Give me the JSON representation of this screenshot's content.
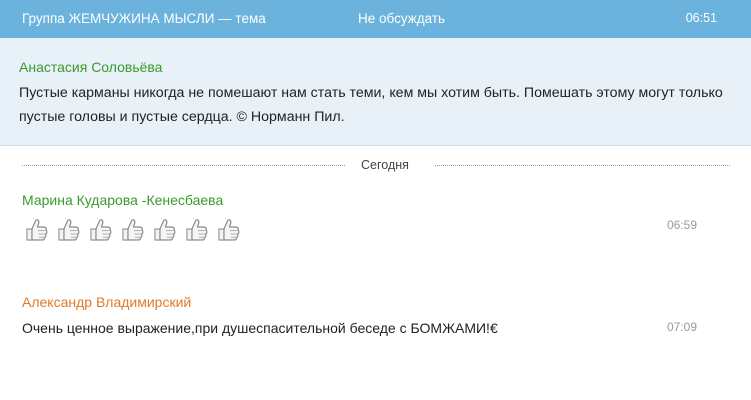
{
  "topbar": {
    "title": "Группа ЖЕМЧУЖИНА МЫСЛИ — тема",
    "mute_label": "Не обсуждать",
    "time": "06:51"
  },
  "topic": {
    "author": "Анастасия Соловьёва",
    "text": "Пустые карманы никогда не помешают нам стать теми, кем мы хотим быть. Помешать этому могут только пустые головы и пустые сердца. © Норманн Пил."
  },
  "divider": {
    "label": "Сегодня"
  },
  "messages": [
    {
      "author": "Марина Кударова -Кенесбаева",
      "time": "06:59",
      "emoji": "thumbs-up-icon",
      "emoji_count": 7
    },
    {
      "author": "Александр Владимирский",
      "time": "07:09",
      "text": "Очень ценное выражение,при душеспасительной беседе с БОМЖАМИ!€"
    }
  ],
  "colors": {
    "topbar_bg": "#6bb3dc",
    "topic_bg": "#e8f1f7",
    "author_green": "#3a9a2d",
    "author_orange": "#e07a2a"
  }
}
